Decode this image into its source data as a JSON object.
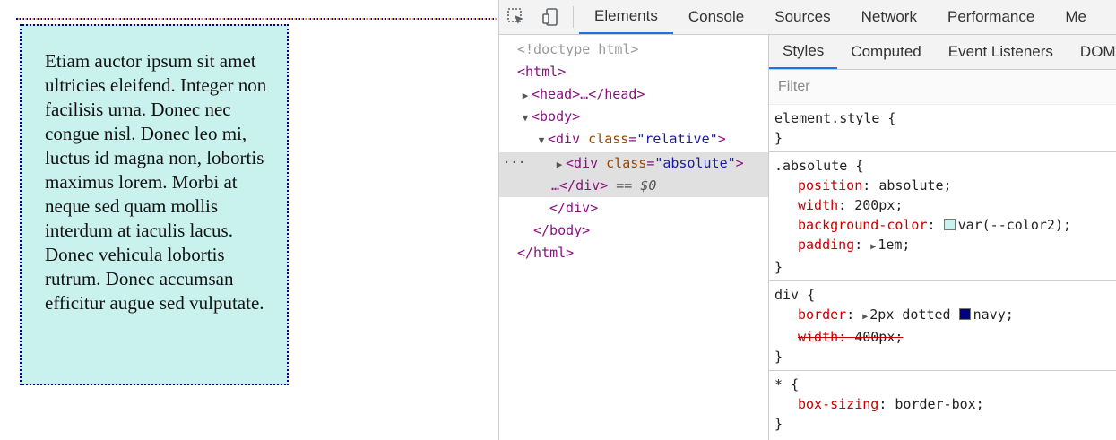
{
  "page": {
    "paragraph": "Etiam auctor ipsum sit amet ultricies eleifend. Integer non facilisis urna. Donec nec congue nisl. Donec leo mi, luctus id magna non, lobortis maximus lorem. Morbi at neque sed quam mollis interdum at iaculis lacus. Donec vehicula lobortis rutrum. Donec accumsan efficitur augue sed vulputate."
  },
  "devtools": {
    "toolbar_icons": [
      "inspect-element-icon",
      "device-toolbar-icon"
    ],
    "tabs": [
      "Elements",
      "Console",
      "Sources",
      "Network",
      "Performance",
      "Me"
    ],
    "active_tab": "Elements",
    "tree": {
      "doctype": "<!doctype html>",
      "html_open": "<html>",
      "head": "<head>…</head>",
      "body_open": "<body>",
      "div_relative_tag": "<div",
      "div_relative_attr": "class",
      "div_relative_value": "\"relative\"",
      "div_absolute_tag": "<div",
      "div_absolute_attr": "class",
      "div_absolute_value": "\"absolute\"",
      "div_absolute_close": "…</div>",
      "selected_marker": "== $0",
      "div_close": "</div>",
      "body_close": "</body>",
      "html_close": "</html>",
      "dots": "···"
    },
    "styles_tabs": [
      "Styles",
      "Computed",
      "Event Listeners",
      "DOM"
    ],
    "active_styles_tab": "Styles",
    "filter_placeholder": "Filter",
    "rules": {
      "element_style": {
        "selector": "element.style {",
        "close": "}"
      },
      "absolute": {
        "selector": ".absolute",
        "position": {
          "name": "position",
          "value": "absolute;"
        },
        "width": {
          "name": "width",
          "value": "200px;"
        },
        "background": {
          "name": "background-color",
          "value": "var(--color2);",
          "swatch_color": "#c9f2ef"
        },
        "padding": {
          "name": "padding",
          "value": "1em;"
        }
      },
      "div": {
        "selector": "div",
        "border": {
          "name": "border",
          "value": "2px dotted",
          "color_word": "navy;",
          "swatch_color": "#000080"
        },
        "width_struck": {
          "name": "width",
          "value": "400px;"
        }
      },
      "universal": {
        "selector": "*",
        "box_sizing": {
          "name": "box-sizing",
          "value": "border-box;"
        }
      }
    }
  }
}
